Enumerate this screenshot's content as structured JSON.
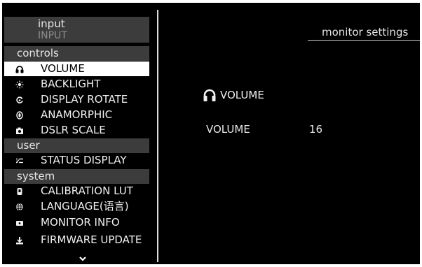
{
  "sidebar": {
    "input_header": {
      "label": "input",
      "current": "INPUT"
    },
    "sections": {
      "controls": "controls",
      "user": "user",
      "system": "system"
    },
    "items": [
      {
        "label": "VOLUME",
        "icon": "headphones-icon",
        "selected": true
      },
      {
        "label": "BACKLIGHT",
        "icon": "sun-icon"
      },
      {
        "label": "DISPLAY ROTATE",
        "icon": "rotate-icon"
      },
      {
        "label": "ANAMORPHIC",
        "icon": "anamorphic-icon"
      },
      {
        "label": "DSLR SCALE",
        "icon": "camera-icon"
      },
      {
        "label": "STATUS DISPLAY",
        "icon": "status-icon"
      },
      {
        "label": "CALIBRATION LUT",
        "icon": "lut-icon"
      },
      {
        "label": "LANGUAGE(语言)",
        "icon": "globe-icon"
      },
      {
        "label": "MONITOR INFO",
        "icon": "monitor-info-icon"
      },
      {
        "label": "FIRMWARE UPDATE",
        "icon": "firmware-icon"
      }
    ],
    "more_icon": "chevron-down-icon"
  },
  "main": {
    "page_title": "monitor settings",
    "panel_heading": "VOLUME",
    "setting": {
      "label": "VOLUME",
      "value": "16"
    }
  },
  "colors": {
    "background": "#000000",
    "section_header": "#3c3c3c",
    "selected_item": "#ffffff",
    "text": "#f0f0f0"
  }
}
